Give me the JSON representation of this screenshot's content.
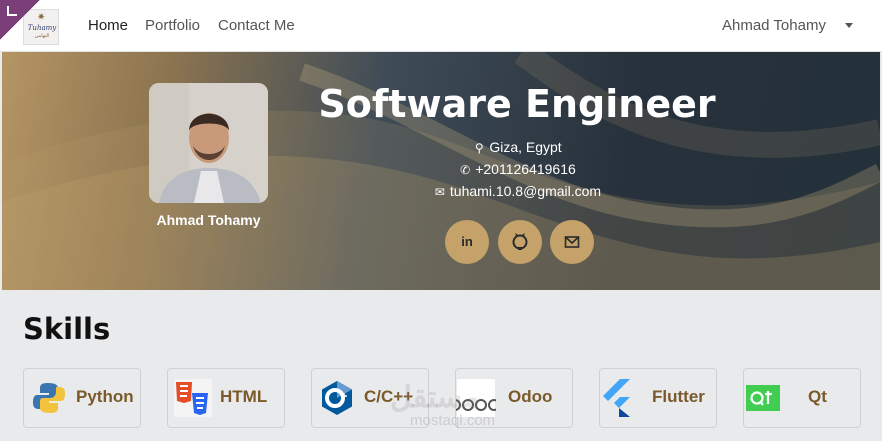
{
  "navbar": {
    "logo_line1": "Tuhamy",
    "logo_line2": "التهامي",
    "links": [
      "Home",
      "Portfolio",
      "Contact Me"
    ],
    "user": "Ahmad Tohamy"
  },
  "hero": {
    "title": "Software Engineer",
    "name": "Ahmad Tohamy",
    "location": "Giza, Egypt",
    "phone": "+201126419616",
    "email": "tuhami.10.8@gmail.com",
    "social_buttons": [
      "in",
      "github-icon",
      "envelope-icon"
    ]
  },
  "skills": {
    "title": "Skills",
    "items": [
      "Python",
      "HTML",
      "C/C++",
      "Odoo",
      "Flutter",
      "Qt"
    ]
  },
  "colors": {
    "accent": "#c4a26a",
    "skill_text": "#7a5a2a",
    "corner": "#7a3e78"
  },
  "watermark": {
    "line1": "مستقل",
    "line2": "mostaql.com"
  }
}
